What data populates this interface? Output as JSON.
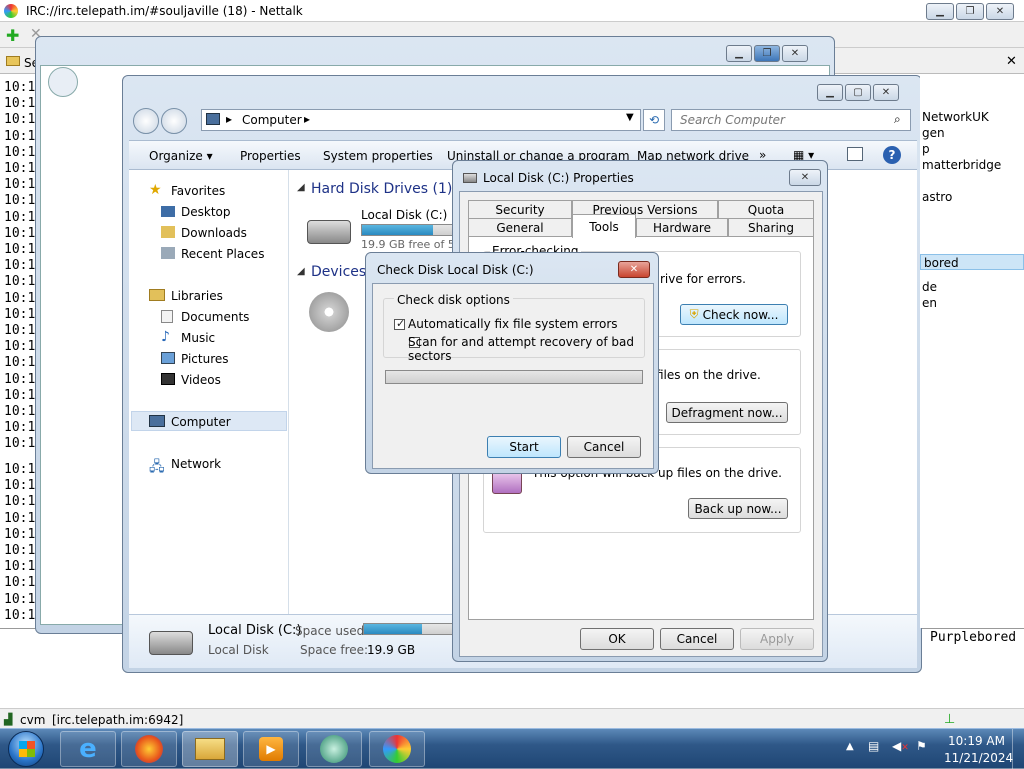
{
  "irc": {
    "title": "IRC://irc.telepath.im/#souljaville (18)  -  Nettalk",
    "timestamps": [
      "10:1",
      "10:1",
      "10:1",
      "10:1",
      "10:1",
      "10:1",
      "10:1",
      "10:1",
      "10:1",
      "10:1",
      "10:1",
      "10:1",
      "10:1",
      "10:1",
      "10:1",
      "10:1",
      "10:1",
      "10:1",
      "10:1",
      "10:1",
      "10:1",
      "10:1",
      "10:1",
      "10:1",
      "10:1",
      "10:1",
      "10:1",
      "10:1",
      "10:1",
      "10:1",
      "10:1",
      "10:1",
      "10:1"
    ],
    "nicks": [
      "NetworkUK",
      "gen",
      "p",
      "matterbridge",
      "astro",
      "bored",
      "de",
      "en"
    ],
    "selected_nick": "bored",
    "input_nick": "Purplebored",
    "status_user": "cvm",
    "status_server": "[irc.telepath.im:6942]",
    "sidebar_label": "Se"
  },
  "explorer": {
    "address": "Computer",
    "search_placeholder": "Search Computer",
    "toolbar": [
      "Organize ▾",
      "Properties",
      "System properties",
      "Uninstall or change a program",
      "Map network drive",
      "»"
    ],
    "nav": {
      "favorites": "Favorites",
      "desktop": "Desktop",
      "downloads": "Downloads",
      "recent": "Recent Places",
      "libraries": "Libraries",
      "documents": "Documents",
      "music": "Music",
      "pictures": "Pictures",
      "videos": "Videos",
      "computer": "Computer",
      "network": "Network"
    },
    "hdd_header": "Hard Disk Drives (1)",
    "devices_header": "Devices",
    "disk_name": "Local Disk (C:)",
    "disk_free": "19.9 GB free of 59",
    "disk_fill": 0.66,
    "details": {
      "name": "Local Disk (C:)",
      "type": "Local Disk",
      "used_label": "Space used:",
      "free_label": "Space free:",
      "free_value": "19.9 GB"
    }
  },
  "props": {
    "title": "Local Disk (C:) Properties",
    "tabs_top": [
      "Security",
      "Previous Versions",
      "Quota"
    ],
    "tabs_bottom": [
      "General",
      "Tools",
      "Hardware",
      "Sharing"
    ],
    "active_tab": "Tools",
    "error_text": "rive for errors.",
    "check_now": "Check now...",
    "defrag_text": "files on the drive.",
    "defrag_button": "Defragment now...",
    "backup_text": "This option will back up files on the drive.",
    "backup_button": "Back up now...",
    "ok": "OK",
    "cancel": "Cancel",
    "apply": "Apply",
    "error_heading": "Error-checking"
  },
  "checkdisk": {
    "title": "Check Disk Local Disk (C:)",
    "group": "Check disk options",
    "option1": "Automatically fix file system errors",
    "option1_checked": true,
    "option2": "Scan for and attempt recovery of bad sectors",
    "option2_checked": false,
    "progress": 0,
    "start": "Start",
    "cancel": "Cancel"
  },
  "tray": {
    "time": "10:19 AM",
    "date": "11/21/2024"
  }
}
